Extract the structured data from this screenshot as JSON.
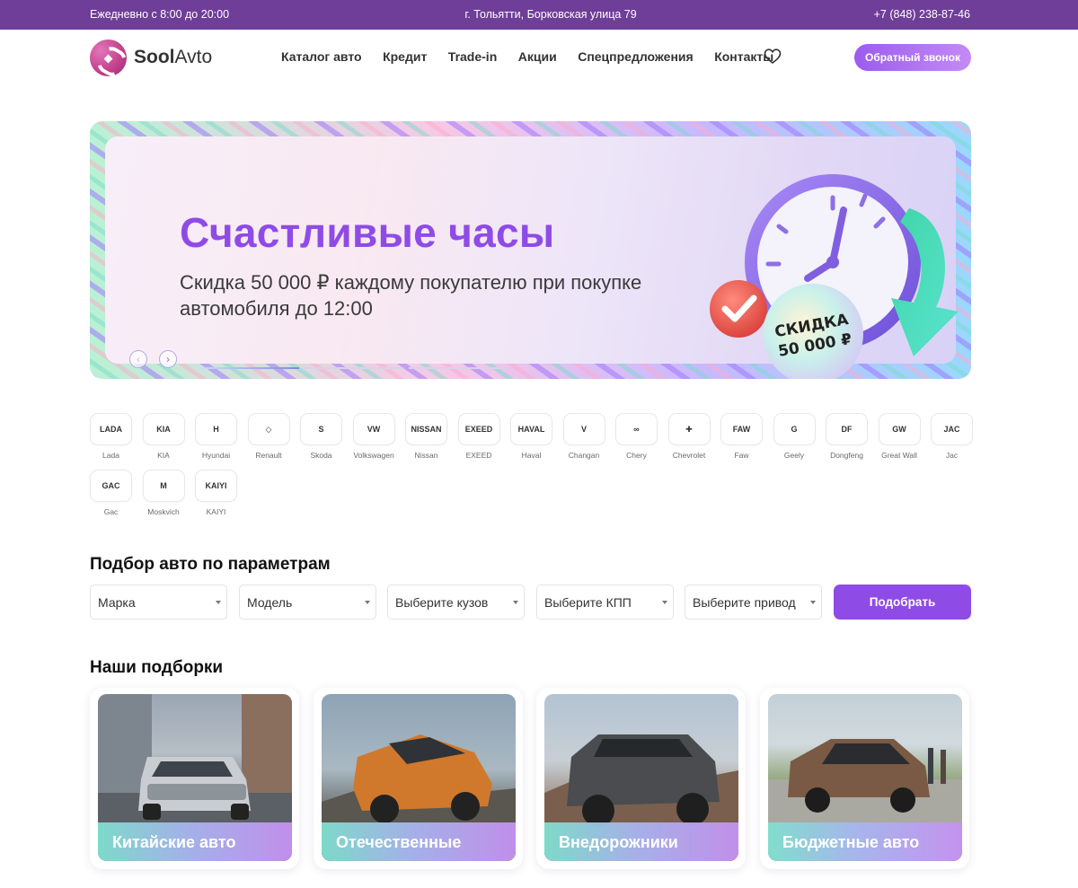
{
  "topbar": {
    "hours": "Ежедневно с 8:00 до 20:00",
    "address": "г. Тольятти, Борковская улица 79",
    "phone": "+7 (848) 238-87-46"
  },
  "header": {
    "logo_bold": "Sool",
    "logo_light": "Avto",
    "nav": [
      "Каталог авто",
      "Кредит",
      "Trade-in",
      "Акции",
      "Спецпредложения",
      "Контакты"
    ],
    "favorites_icon": "heart-icon",
    "callback_label": "Обратный звонок",
    "accent_color": "#8f4be6",
    "topbar_color": "#6f3e98"
  },
  "banner": {
    "title": "Счастливые часы",
    "subtitle": "Скидка 50 000 ₽ каждому покупателю при покупке автомобиля до 12:00",
    "badge_line1": "СКИДКА",
    "badge_line2": "50 000 ₽",
    "prev_icon": "chevron-left-icon",
    "next_icon": "chevron-right-icon",
    "slides_total": 3,
    "active_slide": 1
  },
  "brands": [
    {
      "name": "Lada",
      "logo": "LADA"
    },
    {
      "name": "KIA",
      "logo": "KIA"
    },
    {
      "name": "Hyundai",
      "logo": "H"
    },
    {
      "name": "Renault",
      "logo": "◇"
    },
    {
      "name": "Skoda",
      "logo": "S"
    },
    {
      "name": "Volkswagen",
      "logo": "VW"
    },
    {
      "name": "Nissan",
      "logo": "NISSAN"
    },
    {
      "name": "EXEED",
      "logo": "EXEED"
    },
    {
      "name": "Haval",
      "logo": "HAVAL"
    },
    {
      "name": "Changan",
      "logo": "V"
    },
    {
      "name": "Chery",
      "logo": "∞"
    },
    {
      "name": "Chevrolet",
      "logo": "✚"
    },
    {
      "name": "Faw",
      "logo": "FAW"
    },
    {
      "name": "Geely",
      "logo": "G"
    },
    {
      "name": "Dongfeng",
      "logo": "DF"
    },
    {
      "name": "Great Wall",
      "logo": "GW"
    },
    {
      "name": "Jac",
      "logo": "JAC"
    },
    {
      "name": "Gac",
      "logo": "GAC"
    },
    {
      "name": "Moskvich",
      "logo": "M"
    },
    {
      "name": "KAIYI",
      "logo": "KAIYI"
    }
  ],
  "filter": {
    "title": "Подбор авто по параметрам",
    "selects": [
      "Марка",
      "Модель",
      "Выберите кузов",
      "Выберите КПП",
      "Выберите привод"
    ],
    "submit_label": "Подобрать"
  },
  "collections": {
    "title": "Наши подборки",
    "items": [
      "Китайские авто",
      "Отечественные",
      "Внедорожники",
      "Бюджетные авто"
    ]
  }
}
